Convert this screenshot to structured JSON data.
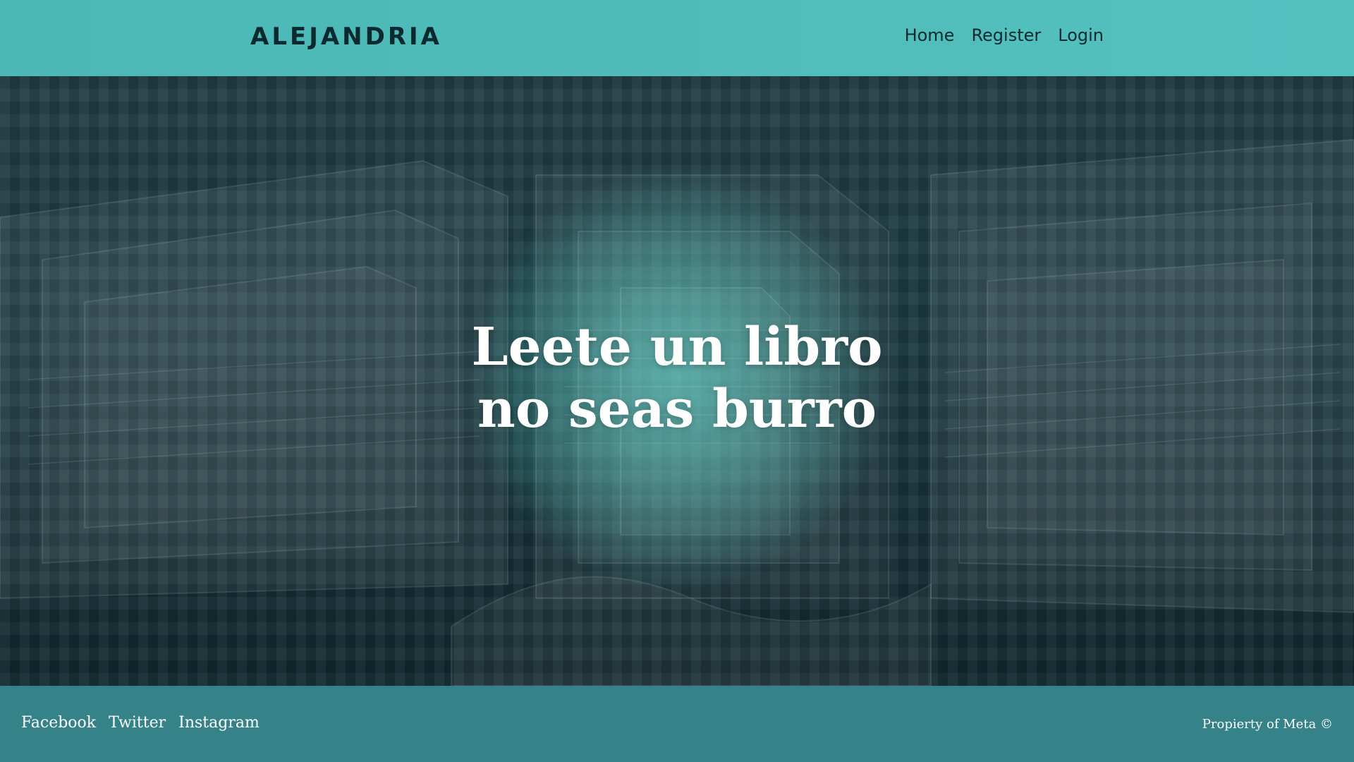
{
  "header": {
    "brand": "ALEJANDRIA",
    "nav": [
      {
        "label": "Home"
      },
      {
        "label": "Register"
      },
      {
        "label": "Login"
      }
    ]
  },
  "hero": {
    "title_line_1": "Leete un libro",
    "title_line_2": "no seas burro"
  },
  "footer": {
    "links": [
      {
        "label": "Facebook"
      },
      {
        "label": "Twitter"
      },
      {
        "label": "Instagram"
      }
    ],
    "copyright": "Propierty of Meta ©"
  },
  "colors": {
    "header": "#4cb8b6",
    "hero": "#1d3a40",
    "footer": "#358389",
    "brand_text": "#0b2a2f",
    "hero_text": "#ffffff"
  }
}
